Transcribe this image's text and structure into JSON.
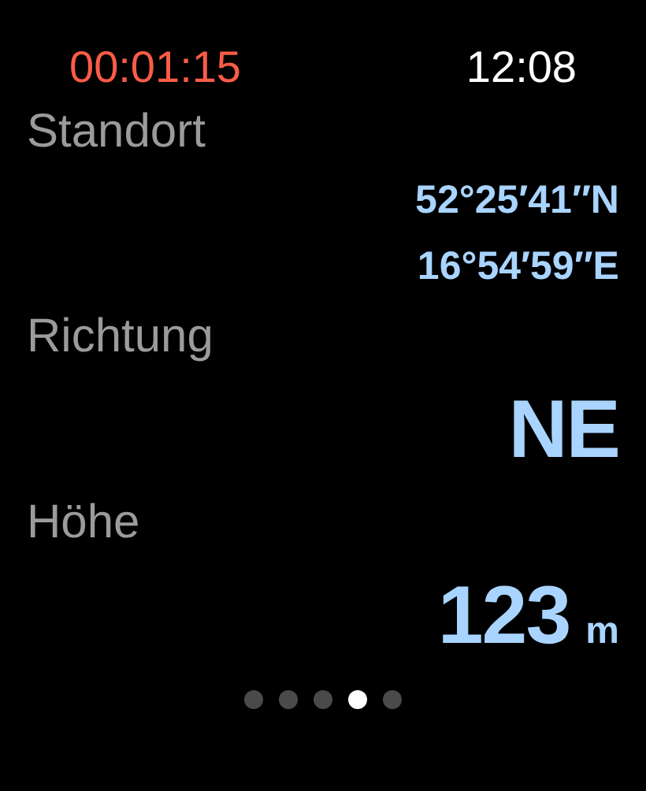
{
  "status_bar": {
    "timer": "00:01:15",
    "time": "12:08"
  },
  "sections": [
    {
      "kind": "coordinates",
      "label": "Standort",
      "lines": [
        "52°25′41″N",
        "16°54′59″E"
      ]
    },
    {
      "kind": "value",
      "label": "Richtung",
      "value": "NE"
    },
    {
      "kind": "measurement",
      "label": "Höhe",
      "value": "123",
      "unit": "m"
    }
  ],
  "page_dots": [
    {
      "selected": false
    },
    {
      "selected": false
    },
    {
      "selected": false
    },
    {
      "selected": true
    },
    {
      "selected": false
    }
  ]
}
